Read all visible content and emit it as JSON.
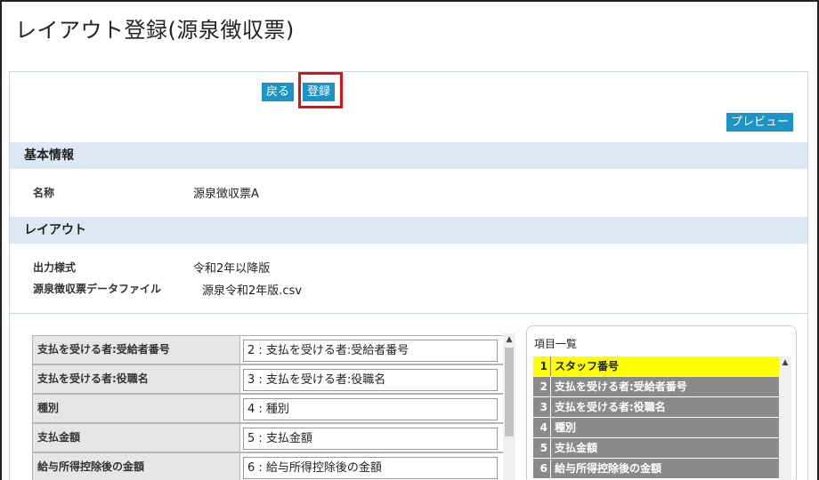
{
  "page": {
    "title": "レイアウト登録(源泉徴収票)"
  },
  "toolbar": {
    "back_label": "戻る",
    "register_label": "登録",
    "preview_label": "プレビュー"
  },
  "basic_info": {
    "header": "基本情報",
    "name_label": "名称",
    "name_value": "源泉徴収票A"
  },
  "layout": {
    "header": "レイアウト",
    "output_style_label": "出力様式",
    "output_style_value": "令和2年以降版",
    "data_file_label": "源泉徴収票データファイル",
    "data_file_value": "源泉令和2年版.csv"
  },
  "mapping": [
    {
      "label": "支払を受ける者:受給者番号",
      "value": "2 : 支払を受ける者:受給者番号"
    },
    {
      "label": "支払を受ける者:役職名",
      "value": "3 : 支払を受ける者:役職名"
    },
    {
      "label": "種別",
      "value": "4 : 種別"
    },
    {
      "label": "支払金額",
      "value": "5 : 支払金額"
    },
    {
      "label": "給与所得控除後の金額",
      "value": "6 : 給与所得控除後の金額"
    }
  ],
  "items_panel": {
    "title": "項目一覧",
    "items": [
      {
        "num": "1",
        "label": "スタッフ番号",
        "selected": true
      },
      {
        "num": "2",
        "label": "支払を受ける者:受給者番号"
      },
      {
        "num": "3",
        "label": "支払を受ける者:役職名"
      },
      {
        "num": "4",
        "label": "種別"
      },
      {
        "num": "5",
        "label": "支払金額"
      },
      {
        "num": "6",
        "label": "給与所得控除後の金額"
      }
    ]
  },
  "colors": {
    "button": "#1a95c6",
    "section_header": "#dde8f4",
    "highlight": "#e01010",
    "selected_item": "#ffff00",
    "item_bg": "#8a8a8a"
  },
  "icons": {
    "scroll_up": "▲"
  }
}
